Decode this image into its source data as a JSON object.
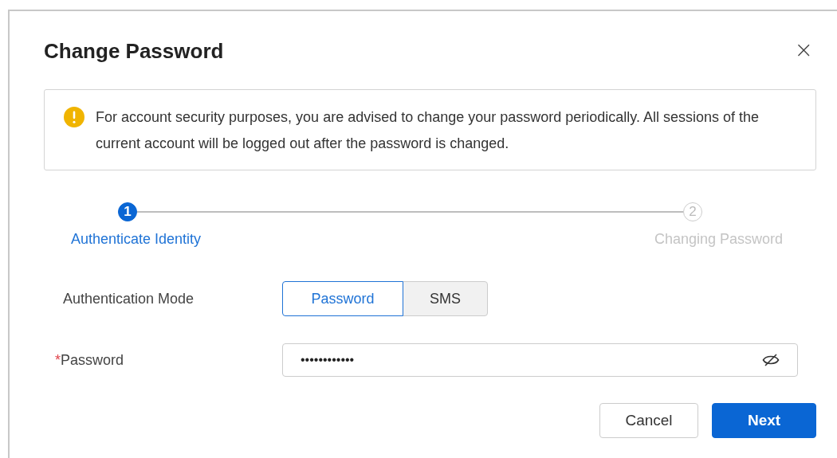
{
  "dialog": {
    "title": "Change Password",
    "close": "×"
  },
  "notice": {
    "text": "For account security purposes, you are advised to change your password periodically. All sessions of the current account will be logged out after the password is changed."
  },
  "steps": [
    {
      "number": "1",
      "label": "Authenticate Identity",
      "active": true
    },
    {
      "number": "2",
      "label": "Changing Password",
      "active": false
    }
  ],
  "auth_mode": {
    "label": "Authentication Mode",
    "options": [
      {
        "label": "Password",
        "selected": true
      },
      {
        "label": "SMS",
        "selected": false
      }
    ]
  },
  "password": {
    "label": "Password",
    "required_mark": "*",
    "value": "••••••••••••"
  },
  "buttons": [
    {
      "label": "Cancel",
      "kind": "secondary"
    },
    {
      "label": "Next",
      "kind": "primary"
    }
  ]
}
